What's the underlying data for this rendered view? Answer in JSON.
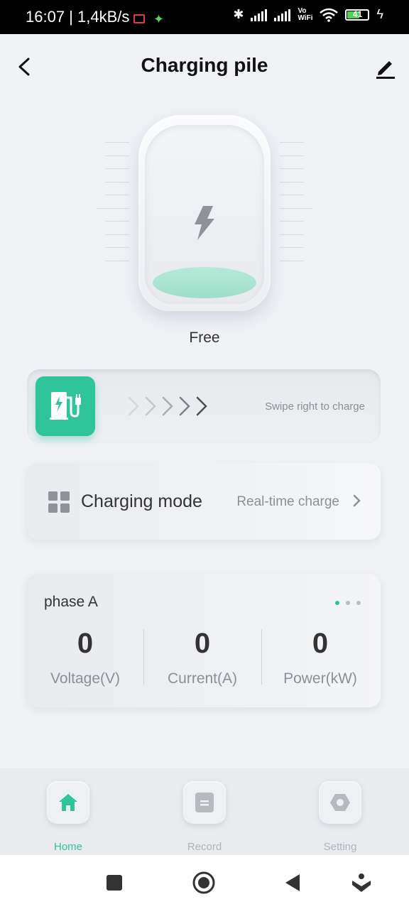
{
  "status_bar": {
    "time": "16:07",
    "net_speed": "1,4kB/s",
    "vowifi_top": "Vo",
    "vowifi_bottom": "WiFi",
    "battery_level": "41"
  },
  "header": {
    "title": "Charging pile",
    "back_icon": "chevron-left-icon",
    "edit_icon": "pencil-icon"
  },
  "pile": {
    "status": "Free"
  },
  "swipe": {
    "hint": "Swipe right to charge"
  },
  "charging_mode": {
    "label": "Charging mode",
    "value": "Real-time charge"
  },
  "phase": {
    "title": "phase A",
    "metrics": [
      {
        "value": "0",
        "label": "Voltage(V)"
      },
      {
        "value": "0",
        "label": "Current(A)"
      },
      {
        "value": "0",
        "label": "Power(kW)"
      }
    ]
  },
  "nav": {
    "items": [
      {
        "label": "Home",
        "icon": "home-icon",
        "active": true
      },
      {
        "label": "Record",
        "icon": "record-icon",
        "active": false
      },
      {
        "label": "Setting",
        "icon": "setting-icon",
        "active": false
      }
    ]
  },
  "colors": {
    "accent": "#2fc49a",
    "background": "#f0f2f6"
  }
}
